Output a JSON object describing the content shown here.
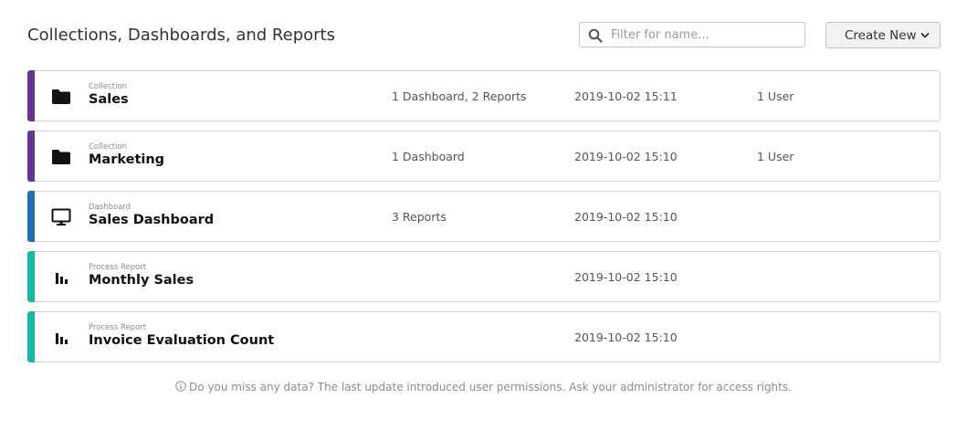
{
  "header": {
    "title": "Collections, Dashboards, and Reports"
  },
  "search": {
    "icon": "search-icon",
    "placeholder": "Filter for name..."
  },
  "create_new": {
    "label": "Create New",
    "icon": "chevron-down-icon"
  },
  "colors": {
    "collection": "#663399",
    "dashboard": "#1f6fb5",
    "report": "#18b5a8"
  },
  "entities": [
    {
      "type_label": "Collection",
      "name": "Sales",
      "contents": "1 Dashboard, 2 Reports",
      "modified": "2019-10-02 15:11",
      "users": "1 User",
      "icon": "folder-icon"
    },
    {
      "type_label": "Collection",
      "name": "Marketing",
      "contents": "1 Dashboard",
      "modified": "2019-10-02 15:10",
      "users": "1 User",
      "icon": "folder-icon"
    },
    {
      "type_label": "Dashboard",
      "name": "Sales Dashboard",
      "contents": "3 Reports",
      "modified": "2019-10-02 15:10",
      "users": "",
      "icon": "monitor-icon"
    },
    {
      "type_label": "Process Report",
      "name": "Monthly Sales",
      "contents": "",
      "modified": "2019-10-02 15:10",
      "users": "",
      "icon": "bar-chart-icon"
    },
    {
      "type_label": "Process Report",
      "name": "Invoice Evaluation Count",
      "contents": "",
      "modified": "2019-10-02 15:10",
      "users": "",
      "icon": "bar-chart-icon"
    }
  ],
  "footer": {
    "icon": "info-icon",
    "note": "Do you miss any data? The last update introduced user permissions. Ask your administrator for access rights."
  }
}
